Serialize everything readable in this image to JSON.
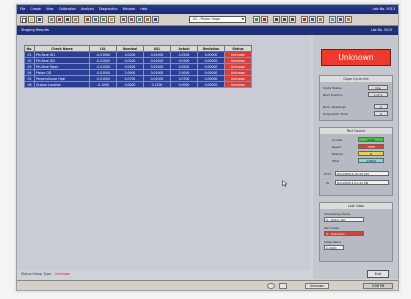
{
  "window": {
    "menu": [
      "File",
      "Create",
      "View",
      "Calibration",
      "Analysis",
      "Diagnostics",
      "Window",
      "Help"
    ],
    "title_right": "Lab No. 5013"
  },
  "toolbar": {
    "selected_check": "02 - Piston Gage"
  },
  "header": {
    "title": "Staging Results",
    "right_label": "Lab No. 5013"
  },
  "table": {
    "columns": [
      "No.",
      "Check Name",
      "LSL",
      "Nominal",
      "USL",
      "Actual",
      "Deviation",
      "Status"
    ],
    "rows": [
      [
        "01",
        "Pts Bore ID1",
        "-0.01000",
        "0.0200",
        "0.01000",
        "0.0200",
        "0.00000",
        "Unknown"
      ],
      [
        "02",
        "Pts Bore ID2",
        "-0.01000",
        "0.0200",
        "0.01000",
        "0.0200",
        "0.00000",
        "Unknown"
      ],
      [
        "03",
        "Pts Bore Taper",
        "-0.01000",
        "0.0200",
        "0.01000",
        "0.0200",
        "0.00000",
        "Unknown"
      ],
      [
        "04",
        "Piston OD",
        "-0.01000",
        "2.0000",
        "0.01000",
        "2.0000",
        "0.00000",
        "Unknown"
      ],
      [
        "05",
        "Perpendicular High",
        "-0.01000",
        "0.0700",
        "0.01000",
        "0.0700",
        "0.00000",
        "Unknown"
      ],
      [
        "06",
        "Groove Location",
        "-0.1000",
        "0.0000",
        "0.1200",
        "0.0000",
        "0.00000",
        "Unknown"
      ]
    ]
  },
  "status_line": {
    "label": "Status Setup Type:",
    "value": "Unknown"
  },
  "side": {
    "result": "Unknown",
    "cycle_panel": {
      "title": "Gage Cycle Info",
      "cycle_status_label": "Cycle Status",
      "cycle_status_value": "Idle",
      "next_position_label": "Next Position",
      "next_position_value": "1 of 4",
      "num_readings_label": "Num. Readings",
      "num_readings_value": "0",
      "acq_time_label": "Acquisition Time",
      "acq_time_value": "0"
    },
    "part_counts": {
      "title": "Part Counts",
      "accept_label": "Accept",
      "accept_value": "1990",
      "reject_label": "Reject",
      "reject_value": "7958",
      "rework_label": "Rework",
      "rework_value": "8",
      "total_label": "Total",
      "total_value": "17804",
      "from_label": "From",
      "from_value": "8/2/2006 9:15:43 AM",
      "to_label": "To",
      "to_value": "8/2/2006 4:01:32 PM"
    },
    "last_class": {
      "title": "Last Class",
      "check_label": "Classifying Check",
      "check_value": "4 - Piston OD",
      "class_label": "Part Class",
      "class_value": "5 - Unknown",
      "value_label": "Class Value",
      "value_value": "0.0000"
    },
    "exit_label": "Exit"
  },
  "taskbar": {
    "left_text": "",
    "item": "Unknown",
    "clock": "3:08 PM"
  }
}
